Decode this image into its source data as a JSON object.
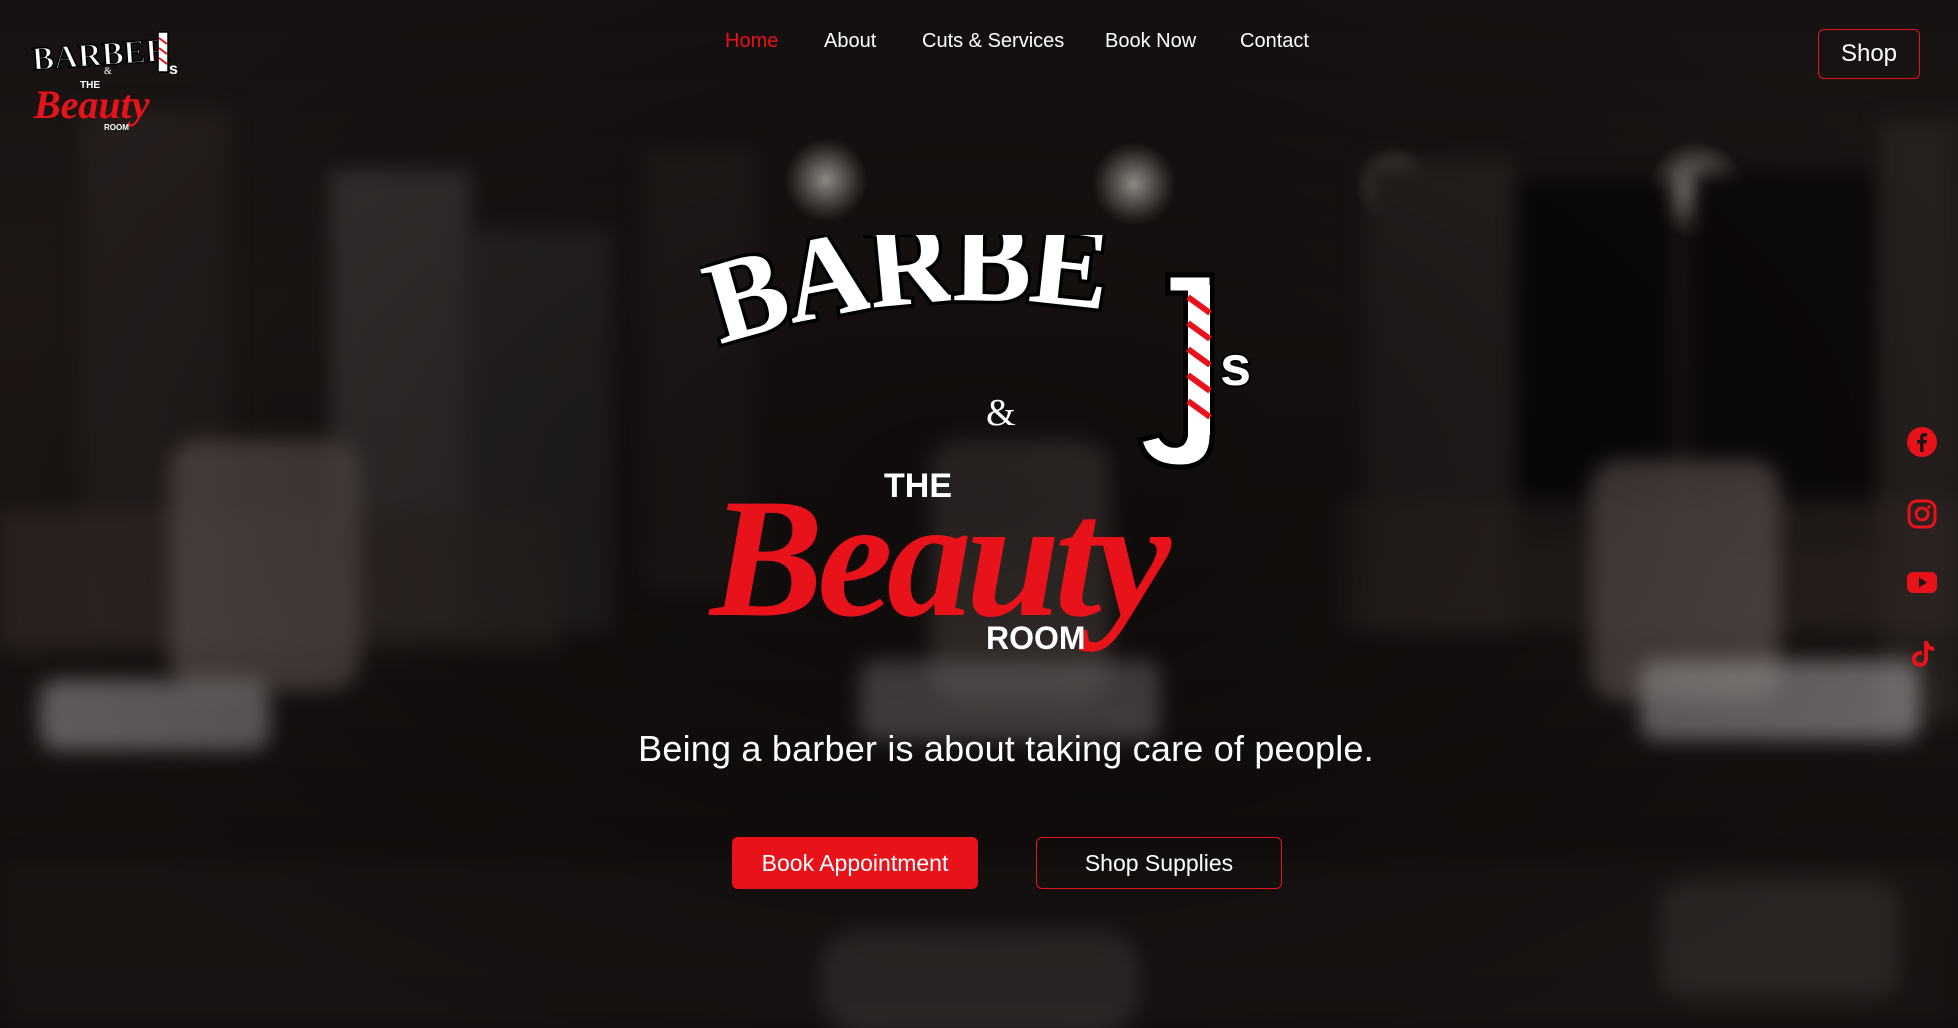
{
  "header": {
    "logo_alt": "Barber J's & The Beauty Room",
    "nav": [
      {
        "label": "Home",
        "active": true
      },
      {
        "label": "About",
        "active": false
      },
      {
        "label": "Cuts & Services",
        "active": false
      },
      {
        "label": "Book Now",
        "active": false
      },
      {
        "label": "Contact",
        "active": false
      }
    ],
    "shop_label": "Shop"
  },
  "hero": {
    "logo": {
      "barber_text": "BARBER",
      "j_text": "J",
      "s_text": "s",
      "amp_text": "&",
      "the_text": "THE",
      "beauty_text": "Beauty",
      "room_text": "ROOM"
    },
    "tagline": "Being a barber is about taking care of people.",
    "book_button": "Book Appointment",
    "shop_button": "Shop Supplies"
  },
  "social": [
    {
      "icon": "facebook-icon"
    },
    {
      "icon": "instagram-icon"
    },
    {
      "icon": "youtube-icon"
    },
    {
      "icon": "tiktok-icon"
    }
  ],
  "colors": {
    "accent": "#e8121b",
    "text": "#ffffff",
    "background": "#1a1514"
  }
}
